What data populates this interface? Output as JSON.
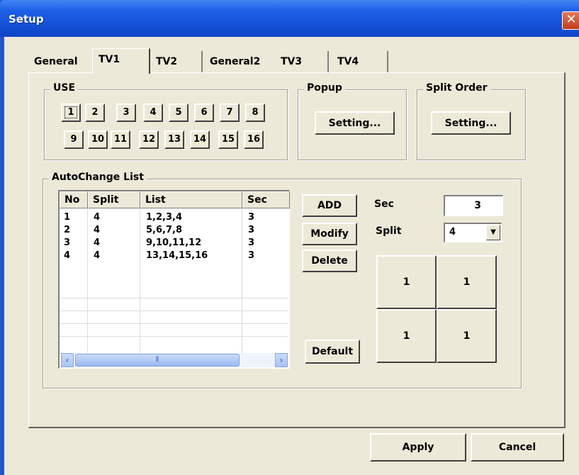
{
  "window": {
    "title": "Setup",
    "close_glyph": "✕"
  },
  "tabs": [
    {
      "label": "General",
      "active": false
    },
    {
      "label": "TV1",
      "active": true
    },
    {
      "label": "TV2",
      "active": false
    },
    {
      "label": "General2",
      "active": false
    },
    {
      "label": "TV3",
      "active": false
    },
    {
      "label": "TV4",
      "active": false
    }
  ],
  "use_group": {
    "title": "USE",
    "channels_row1": [
      "1",
      "2",
      "3",
      "4",
      "5",
      "6",
      "7",
      "8"
    ],
    "channels_row2": [
      "9",
      "10",
      "11",
      "12",
      "13",
      "14",
      "15",
      "16"
    ]
  },
  "popup_group": {
    "title": "Popup",
    "button_label": "Setting..."
  },
  "split_order_group": {
    "title": "Split Order",
    "button_label": "Setting..."
  },
  "autochange": {
    "title": "AutoChange List",
    "columns": [
      "No",
      "Split",
      "List",
      "Sec"
    ],
    "rows": [
      {
        "no": "1",
        "split": "4",
        "list": "1,2,3,4",
        "sec": "3"
      },
      {
        "no": "2",
        "split": "4",
        "list": "5,6,7,8",
        "sec": "3"
      },
      {
        "no": "3",
        "split": "4",
        "list": "9,10,11,12",
        "sec": "3"
      },
      {
        "no": "4",
        "split": "4",
        "list": "13,14,15,16",
        "sec": "3"
      }
    ],
    "scroll_left": "‹",
    "scroll_right": "›",
    "scroll_thumb_grip": "⦀",
    "buttons": {
      "add": "ADD",
      "modify": "Modify",
      "delete": "Delete",
      "default": "Default"
    },
    "sec_label": "Sec",
    "sec_value": "3",
    "split_label": "Split",
    "split_value": "4",
    "split_dropdown_glyph": "▼",
    "preview_cells": [
      "1",
      "1",
      "1",
      "1"
    ]
  },
  "footer": {
    "apply": "Apply",
    "cancel": "Cancel"
  },
  "colors": {
    "titlebar": "#1450d8",
    "face": "#ece9d8",
    "close": "#c43a1c"
  }
}
